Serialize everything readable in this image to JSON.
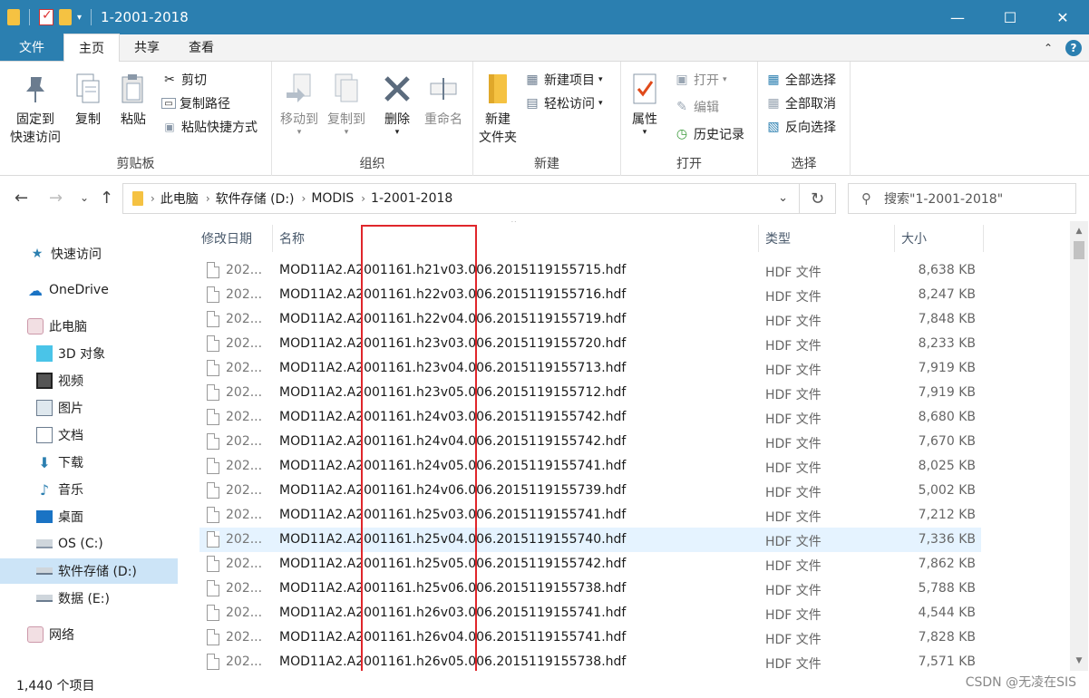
{
  "window": {
    "title": "1-2001-2018",
    "controls": {
      "minimize": "—",
      "maximize": "☐",
      "close": "✕"
    }
  },
  "ribbon_tabs": [
    "文件",
    "主页",
    "共享",
    "查看"
  ],
  "ribbon": {
    "clipboard": {
      "label": "剪贴板",
      "pin": "固定到\n快速访问",
      "copy": "复制",
      "paste": "粘贴",
      "cut": "剪切",
      "copy_path": "复制路径",
      "paste_shortcut": "粘贴快捷方式"
    },
    "organize": {
      "label": "组织",
      "move_to": "移动到",
      "copy_to": "复制到",
      "delete": "删除",
      "rename": "重命名"
    },
    "new": {
      "label": "新建",
      "new_folder": "新建\n文件夹",
      "new_item": "新建项目",
      "easy_access": "轻松访问"
    },
    "open": {
      "label": "打开",
      "properties": "属性",
      "open": "打开",
      "edit": "编辑",
      "history": "历史记录"
    },
    "select": {
      "label": "选择",
      "select_all": "全部选择",
      "select_none": "全部取消",
      "invert": "反向选择"
    }
  },
  "address": {
    "crumbs": [
      "此电脑",
      "软件存储 (D:)",
      "MODIS",
      "1-2001-2018"
    ],
    "search_placeholder": "搜索\"1-2001-2018\""
  },
  "nav_pane": [
    {
      "label": "快速访问",
      "icon": "star-icon",
      "selected": false
    },
    {
      "label": "OneDrive",
      "icon": "cloud-icon",
      "selected": false
    },
    {
      "label": "此电脑",
      "icon": "computer-icon",
      "selected": false
    },
    {
      "label": "3D 对象",
      "icon": "cube-icon",
      "selected": false
    },
    {
      "label": "视频",
      "icon": "video-icon",
      "selected": false
    },
    {
      "label": "图片",
      "icon": "picture-icon",
      "selected": false
    },
    {
      "label": "文档",
      "icon": "document-icon",
      "selected": false
    },
    {
      "label": "下载",
      "icon": "download-icon",
      "selected": false
    },
    {
      "label": "音乐",
      "icon": "music-icon",
      "selected": false
    },
    {
      "label": "桌面",
      "icon": "desktop-icon",
      "selected": false
    },
    {
      "label": "OS (C:)",
      "icon": "drive-icon",
      "selected": false
    },
    {
      "label": "软件存储 (D:)",
      "icon": "drive-icon",
      "selected": true
    },
    {
      "label": "数据 (E:)",
      "icon": "drive-icon",
      "selected": false
    },
    {
      "label": "网络",
      "icon": "network-icon",
      "selected": false
    }
  ],
  "columns": {
    "date": "修改日期",
    "name": "名称",
    "type": "类型",
    "size": "大小"
  },
  "files": [
    {
      "date": "202...",
      "name": "MOD11A2.A2001161.h21v03.006.2015119155715.hdf",
      "type": "HDF 文件",
      "size": "8,638 KB"
    },
    {
      "date": "202...",
      "name": "MOD11A2.A2001161.h22v03.006.2015119155716.hdf",
      "type": "HDF 文件",
      "size": "8,247 KB"
    },
    {
      "date": "202...",
      "name": "MOD11A2.A2001161.h22v04.006.2015119155719.hdf",
      "type": "HDF 文件",
      "size": "7,848 KB"
    },
    {
      "date": "202...",
      "name": "MOD11A2.A2001161.h23v03.006.2015119155720.hdf",
      "type": "HDF 文件",
      "size": "8,233 KB"
    },
    {
      "date": "202...",
      "name": "MOD11A2.A2001161.h23v04.006.2015119155713.hdf",
      "type": "HDF 文件",
      "size": "7,919 KB"
    },
    {
      "date": "202...",
      "name": "MOD11A2.A2001161.h23v05.006.2015119155712.hdf",
      "type": "HDF 文件",
      "size": "7,919 KB"
    },
    {
      "date": "202...",
      "name": "MOD11A2.A2001161.h24v03.006.2015119155742.hdf",
      "type": "HDF 文件",
      "size": "8,680 KB"
    },
    {
      "date": "202...",
      "name": "MOD11A2.A2001161.h24v04.006.2015119155742.hdf",
      "type": "HDF 文件",
      "size": "7,670 KB"
    },
    {
      "date": "202...",
      "name": "MOD11A2.A2001161.h24v05.006.2015119155741.hdf",
      "type": "HDF 文件",
      "size": "8,025 KB"
    },
    {
      "date": "202...",
      "name": "MOD11A2.A2001161.h24v06.006.2015119155739.hdf",
      "type": "HDF 文件",
      "size": "5,002 KB"
    },
    {
      "date": "202...",
      "name": "MOD11A2.A2001161.h25v03.006.2015119155741.hdf",
      "type": "HDF 文件",
      "size": "7,212 KB"
    },
    {
      "date": "202...",
      "name": "MOD11A2.A2001161.h25v04.006.2015119155740.hdf",
      "type": "HDF 文件",
      "size": "7,336 KB",
      "hover": true
    },
    {
      "date": "202...",
      "name": "MOD11A2.A2001161.h25v05.006.2015119155742.hdf",
      "type": "HDF 文件",
      "size": "7,862 KB"
    },
    {
      "date": "202...",
      "name": "MOD11A2.A2001161.h25v06.006.2015119155738.hdf",
      "type": "HDF 文件",
      "size": "5,788 KB"
    },
    {
      "date": "202...",
      "name": "MOD11A2.A2001161.h26v03.006.2015119155741.hdf",
      "type": "HDF 文件",
      "size": "4,544 KB"
    },
    {
      "date": "202...",
      "name": "MOD11A2.A2001161.h26v04.006.2015119155741.hdf",
      "type": "HDF 文件",
      "size": "7,828 KB"
    },
    {
      "date": "202...",
      "name": "MOD11A2.A2001161.h26v05.006.2015119155738.hdf",
      "type": "HDF 文件",
      "size": "7,571 KB"
    }
  ],
  "status": {
    "item_count": "1,440 个项目"
  },
  "watermark": "CSDN @无凌在SIS",
  "colors": {
    "accent": "#2b7fb0",
    "highlight_box": "#e0262b",
    "selected": "#cce4f7",
    "hover": "#e5f3ff"
  }
}
